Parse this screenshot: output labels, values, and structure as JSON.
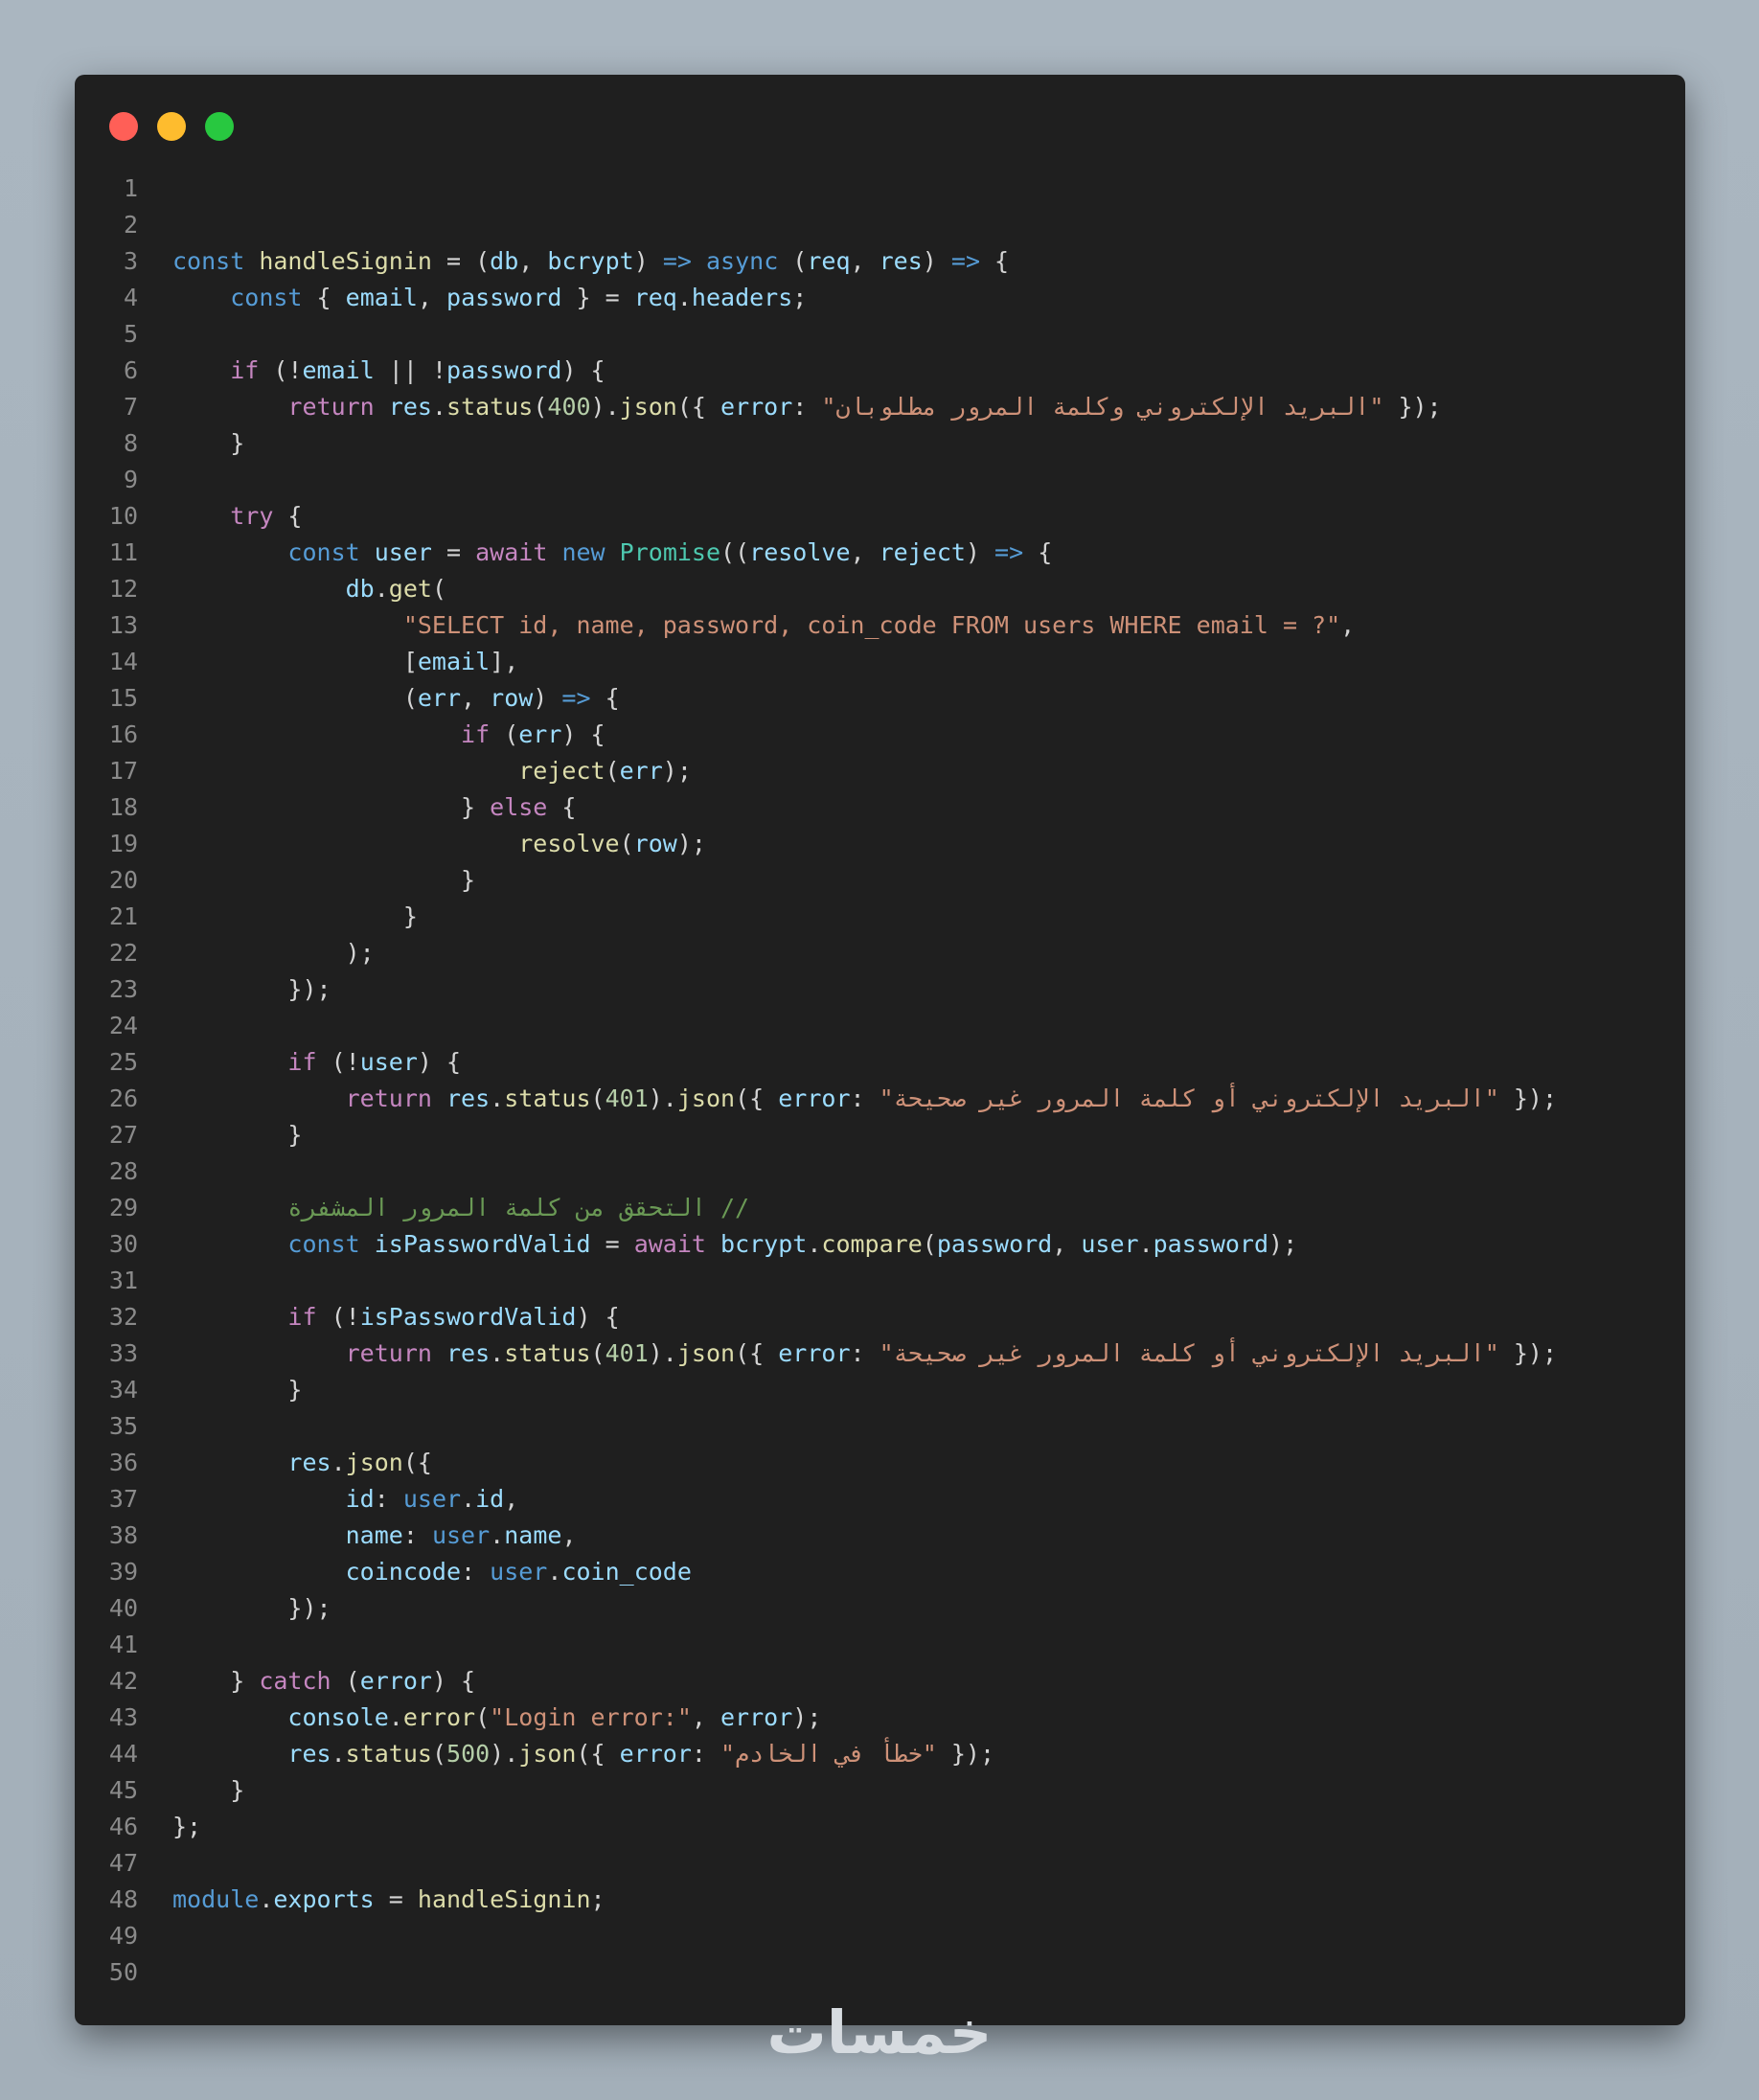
{
  "window": {
    "controls": [
      {
        "name": "close-button",
        "color": "#ff5f57"
      },
      {
        "name": "minimize-button",
        "color": "#febc2e"
      },
      {
        "name": "maximize-button",
        "color": "#28c840"
      }
    ]
  },
  "editor": {
    "lines": [
      [],
      [],
      [
        [
          "kw",
          "const"
        ],
        [
          "p",
          " "
        ],
        [
          "fn",
          "handleSignin"
        ],
        [
          "p",
          " = ("
        ],
        [
          "var",
          "db"
        ],
        [
          "p",
          ", "
        ],
        [
          "var",
          "bcrypt"
        ],
        [
          "p",
          ") "
        ],
        [
          "kw",
          "=>"
        ],
        [
          "p",
          " "
        ],
        [
          "kw",
          "async"
        ],
        [
          "p",
          " ("
        ],
        [
          "var",
          "req"
        ],
        [
          "p",
          ", "
        ],
        [
          "var",
          "res"
        ],
        [
          "p",
          ") "
        ],
        [
          "kw",
          "=>"
        ],
        [
          "p",
          " {"
        ]
      ],
      [
        [
          "p",
          "    "
        ],
        [
          "kw",
          "const"
        ],
        [
          "p",
          " { "
        ],
        [
          "var",
          "email"
        ],
        [
          "p",
          ", "
        ],
        [
          "var",
          "password"
        ],
        [
          "p",
          " } = "
        ],
        [
          "var",
          "req"
        ],
        [
          "p",
          "."
        ],
        [
          "var",
          "headers"
        ],
        [
          "p",
          ";"
        ]
      ],
      [],
      [
        [
          "p",
          "    "
        ],
        [
          "ctl",
          "if"
        ],
        [
          "p",
          " (!"
        ],
        [
          "var",
          "email"
        ],
        [
          "p",
          " || !"
        ],
        [
          "var",
          "password"
        ],
        [
          "p",
          ") {"
        ]
      ],
      [
        [
          "p",
          "        "
        ],
        [
          "ctl",
          "return"
        ],
        [
          "p",
          " "
        ],
        [
          "var",
          "res"
        ],
        [
          "p",
          "."
        ],
        [
          "fn",
          "status"
        ],
        [
          "p",
          "("
        ],
        [
          "num",
          "400"
        ],
        [
          "p",
          ")."
        ],
        [
          "fn",
          "json"
        ],
        [
          "p",
          "({ "
        ],
        [
          "var",
          "error"
        ],
        [
          "p",
          ": "
        ],
        [
          "str",
          "\"البريد الإلكتروني وكلمة المرور مطلوبان\""
        ],
        [
          "p",
          " });"
        ]
      ],
      [
        [
          "p",
          "    }"
        ]
      ],
      [],
      [
        [
          "p",
          "    "
        ],
        [
          "ctl",
          "try"
        ],
        [
          "p",
          " {"
        ]
      ],
      [
        [
          "p",
          "        "
        ],
        [
          "kw",
          "const"
        ],
        [
          "p",
          " "
        ],
        [
          "var",
          "user"
        ],
        [
          "p",
          " = "
        ],
        [
          "ctl",
          "await"
        ],
        [
          "p",
          " "
        ],
        [
          "kw",
          "new"
        ],
        [
          "p",
          " "
        ],
        [
          "cls",
          "Promise"
        ],
        [
          "p",
          "(("
        ],
        [
          "var",
          "resolve"
        ],
        [
          "p",
          ", "
        ],
        [
          "var",
          "reject"
        ],
        [
          "p",
          ") "
        ],
        [
          "kw",
          "=>"
        ],
        [
          "p",
          " {"
        ]
      ],
      [
        [
          "p",
          "            "
        ],
        [
          "var",
          "db"
        ],
        [
          "p",
          "."
        ],
        [
          "fn",
          "get"
        ],
        [
          "p",
          "("
        ]
      ],
      [
        [
          "p",
          "                "
        ],
        [
          "str",
          "\"SELECT id, name, password, coin_code FROM users WHERE email = ?\""
        ],
        [
          "p",
          ","
        ]
      ],
      [
        [
          "p",
          "                ["
        ],
        [
          "var",
          "email"
        ],
        [
          "p",
          "],"
        ]
      ],
      [
        [
          "p",
          "                ("
        ],
        [
          "var",
          "err"
        ],
        [
          "p",
          ", "
        ],
        [
          "var",
          "row"
        ],
        [
          "p",
          ") "
        ],
        [
          "kw",
          "=>"
        ],
        [
          "p",
          " {"
        ]
      ],
      [
        [
          "p",
          "                    "
        ],
        [
          "ctl",
          "if"
        ],
        [
          "p",
          " ("
        ],
        [
          "var",
          "err"
        ],
        [
          "p",
          ") {"
        ]
      ],
      [
        [
          "p",
          "                        "
        ],
        [
          "fn",
          "reject"
        ],
        [
          "p",
          "("
        ],
        [
          "var",
          "err"
        ],
        [
          "p",
          ");"
        ]
      ],
      [
        [
          "p",
          "                    } "
        ],
        [
          "ctl",
          "else"
        ],
        [
          "p",
          " {"
        ]
      ],
      [
        [
          "p",
          "                        "
        ],
        [
          "fn",
          "resolve"
        ],
        [
          "p",
          "("
        ],
        [
          "var",
          "row"
        ],
        [
          "p",
          ");"
        ]
      ],
      [
        [
          "p",
          "                    }"
        ]
      ],
      [
        [
          "p",
          "                }"
        ]
      ],
      [
        [
          "p",
          "            );"
        ]
      ],
      [
        [
          "p",
          "        });"
        ]
      ],
      [],
      [
        [
          "p",
          "        "
        ],
        [
          "ctl",
          "if"
        ],
        [
          "p",
          " (!"
        ],
        [
          "var",
          "user"
        ],
        [
          "p",
          ") {"
        ]
      ],
      [
        [
          "p",
          "            "
        ],
        [
          "ctl",
          "return"
        ],
        [
          "p",
          " "
        ],
        [
          "var",
          "res"
        ],
        [
          "p",
          "."
        ],
        [
          "fn",
          "status"
        ],
        [
          "p",
          "("
        ],
        [
          "num",
          "401"
        ],
        [
          "p",
          ")."
        ],
        [
          "fn",
          "json"
        ],
        [
          "p",
          "({ "
        ],
        [
          "var",
          "error"
        ],
        [
          "p",
          ": "
        ],
        [
          "str",
          "\"البريد الإلكتروني أو كلمة المرور غير صحيحة\""
        ],
        [
          "p",
          " });"
        ]
      ],
      [
        [
          "p",
          "        }"
        ]
      ],
      [],
      [
        [
          "p",
          "        "
        ],
        [
          "cmt",
          "// التحقق من كلمة المرور المشفرة"
        ]
      ],
      [
        [
          "p",
          "        "
        ],
        [
          "kw",
          "const"
        ],
        [
          "p",
          " "
        ],
        [
          "var",
          "isPasswordValid"
        ],
        [
          "p",
          " = "
        ],
        [
          "ctl",
          "await"
        ],
        [
          "p",
          " "
        ],
        [
          "var",
          "bcrypt"
        ],
        [
          "p",
          "."
        ],
        [
          "fn",
          "compare"
        ],
        [
          "p",
          "("
        ],
        [
          "var",
          "password"
        ],
        [
          "p",
          ", "
        ],
        [
          "var",
          "user"
        ],
        [
          "p",
          "."
        ],
        [
          "var",
          "password"
        ],
        [
          "p",
          ");"
        ]
      ],
      [],
      [
        [
          "p",
          "        "
        ],
        [
          "ctl",
          "if"
        ],
        [
          "p",
          " (!"
        ],
        [
          "var",
          "isPasswordValid"
        ],
        [
          "p",
          ") {"
        ]
      ],
      [
        [
          "p",
          "            "
        ],
        [
          "ctl",
          "return"
        ],
        [
          "p",
          " "
        ],
        [
          "var",
          "res"
        ],
        [
          "p",
          "."
        ],
        [
          "fn",
          "status"
        ],
        [
          "p",
          "("
        ],
        [
          "num",
          "401"
        ],
        [
          "p",
          ")."
        ],
        [
          "fn",
          "json"
        ],
        [
          "p",
          "({ "
        ],
        [
          "var",
          "error"
        ],
        [
          "p",
          ": "
        ],
        [
          "str",
          "\"البريد الإلكتروني أو كلمة المرور غير صحيحة\""
        ],
        [
          "p",
          " });"
        ]
      ],
      [
        [
          "p",
          "        }"
        ]
      ],
      [],
      [
        [
          "p",
          "        "
        ],
        [
          "var",
          "res"
        ],
        [
          "p",
          "."
        ],
        [
          "fn",
          "json"
        ],
        [
          "p",
          "({"
        ]
      ],
      [
        [
          "p",
          "            "
        ],
        [
          "var",
          "id"
        ],
        [
          "p",
          ": "
        ],
        [
          "kw",
          "user"
        ],
        [
          "p",
          "."
        ],
        [
          "var",
          "id"
        ],
        [
          "p",
          ","
        ]
      ],
      [
        [
          "p",
          "            "
        ],
        [
          "var",
          "name"
        ],
        [
          "p",
          ": "
        ],
        [
          "kw",
          "user"
        ],
        [
          "p",
          "."
        ],
        [
          "var",
          "name"
        ],
        [
          "p",
          ","
        ]
      ],
      [
        [
          "p",
          "            "
        ],
        [
          "var",
          "coincode"
        ],
        [
          "p",
          ": "
        ],
        [
          "kw",
          "user"
        ],
        [
          "p",
          "."
        ],
        [
          "var",
          "coin_code"
        ]
      ],
      [
        [
          "p",
          "        });"
        ]
      ],
      [],
      [
        [
          "p",
          "    } "
        ],
        [
          "ctl",
          "catch"
        ],
        [
          "p",
          " ("
        ],
        [
          "var",
          "error"
        ],
        [
          "p",
          ") {"
        ]
      ],
      [
        [
          "p",
          "        "
        ],
        [
          "var",
          "console"
        ],
        [
          "p",
          "."
        ],
        [
          "fn",
          "error"
        ],
        [
          "p",
          "("
        ],
        [
          "str",
          "\"Login error:\""
        ],
        [
          "p",
          ", "
        ],
        [
          "var",
          "error"
        ],
        [
          "p",
          ");"
        ]
      ],
      [
        [
          "p",
          "        "
        ],
        [
          "var",
          "res"
        ],
        [
          "p",
          "."
        ],
        [
          "fn",
          "status"
        ],
        [
          "p",
          "("
        ],
        [
          "num",
          "500"
        ],
        [
          "p",
          ")."
        ],
        [
          "fn",
          "json"
        ],
        [
          "p",
          "({ "
        ],
        [
          "var",
          "error"
        ],
        [
          "p",
          ": "
        ],
        [
          "str",
          "\"خطأ في الخادم\""
        ],
        [
          "p",
          " });"
        ]
      ],
      [
        [
          "p",
          "    }"
        ]
      ],
      [
        [
          "p",
          "};"
        ]
      ],
      [],
      [
        [
          "kw",
          "module"
        ],
        [
          "p",
          "."
        ],
        [
          "var",
          "exports"
        ],
        [
          "p",
          " = "
        ],
        [
          "fn",
          "handleSignin"
        ],
        [
          "p",
          ";"
        ]
      ],
      [],
      []
    ]
  },
  "watermark": "خمسات"
}
